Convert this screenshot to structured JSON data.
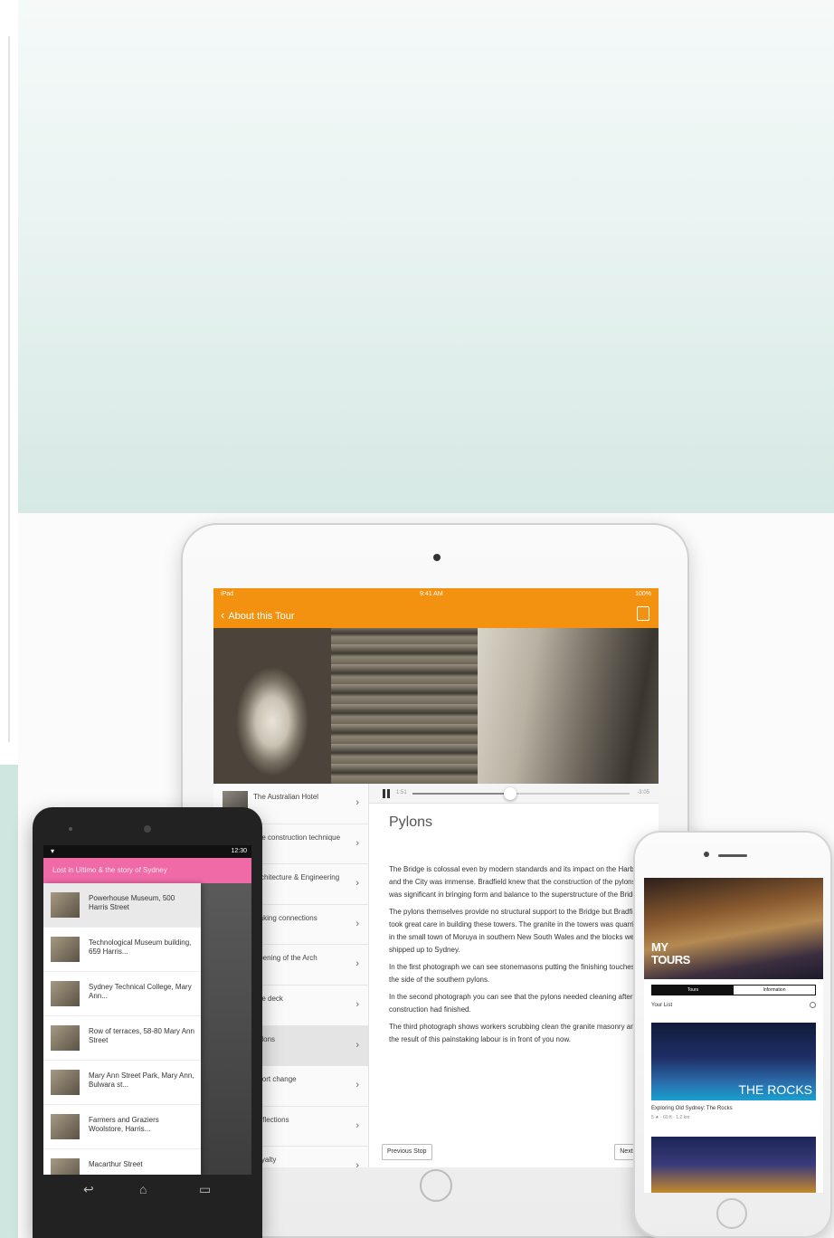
{
  "ipad": {
    "status": {
      "left": "iPad",
      "time": "9:41 AM",
      "battery": "100%"
    },
    "nav": {
      "back_label": "About this Tour",
      "back_icon": "chevron-left-icon",
      "share_icon": "share-icon"
    },
    "list": [
      {
        "label": "The Australian Hotel"
      },
      {
        "label": "The construction technique"
      },
      {
        "label": "Architecture & Engineering"
      },
      {
        "label": "Making connections"
      },
      {
        "label": "Opening of the Arch"
      },
      {
        "label": "The deck"
      },
      {
        "label": "Pylons",
        "selected": true
      },
      {
        "label": "Short change"
      },
      {
        "label": "Reflections"
      },
      {
        "label": "Loyalty"
      }
    ],
    "audio": {
      "elapsed": "1:51",
      "total": "-3:05",
      "progress_percent": 45
    },
    "stop_title": "Pylons",
    "paragraphs": [
      "The Bridge is colossal even by modern standards and its impact on the Harbour and the City was immense. Bradfield knew that the construction of the pylons was significant in bringing form and balance to the superstructure of the Bridge.",
      "The pylons themselves provide no structural support to the Bridge but Bradfield took great care in building these towers. The granite in the towers was quarried in the small town of Moruya in southern New South Wales and the blocks were shipped up to Sydney.",
      "In the first photograph we can see stonemasons putting the finishing touches to the side of the southern pylons.",
      "In the second photograph you can see that the pylons needed cleaning after construction had finished.",
      "The third photograph shows workers scrubbing clean the granite masonry and the result of this painstaking labour is in front of you now."
    ],
    "prev_label": "Previous Stop",
    "next_label": "Next Stop"
  },
  "android": {
    "status_time": "12:30",
    "appbar_title": "Lost in Ultimo & the story of Sydney",
    "items": [
      {
        "label": "Powerhouse Museum, 500 Harris Street",
        "selected": true
      },
      {
        "label": "Technological Museum building, 659 Harris..."
      },
      {
        "label": "Sydney Technical College, Mary Ann..."
      },
      {
        "label": "Row of terraces, 58-80 Mary Ann Street"
      },
      {
        "label": "Mary Ann Street Park, Mary Ann, Bulwara st..."
      },
      {
        "label": "Farmers and Graziers Woolstore, Harris..."
      },
      {
        "label": "Macarthur Street"
      }
    ],
    "nav_icons": [
      "back-icon",
      "home-icon",
      "recents-icon"
    ]
  },
  "iphone": {
    "hero_text": "MY\nTOURS",
    "tabs": [
      {
        "label": "Tours",
        "active": true
      },
      {
        "label": "Information",
        "active": false
      }
    ],
    "section_label": "Your List",
    "card1_title": "THE ROCKS",
    "card1_caption": "Exploring Old Sydney: The Rocks",
    "card1_meta": "5 ★ · 60 ft · 1.2 km",
    "card2_title": ""
  }
}
